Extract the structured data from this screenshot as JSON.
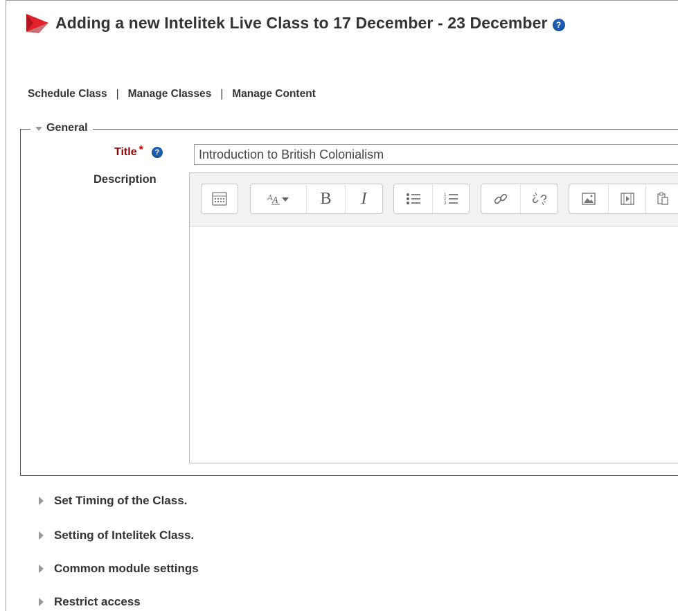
{
  "page": {
    "title": "Adding a new Intelitek Live Class to 17 December - 23 December",
    "help": "?"
  },
  "nav": {
    "items": [
      "Schedule Class",
      "Manage Classes",
      "Manage Content"
    ],
    "separator": "|"
  },
  "general": {
    "legend": "General",
    "title_label": "Title",
    "required_mark": "*",
    "help": "?",
    "title_value": "Introduction to British Colonialism",
    "description_label": "Description"
  },
  "editor": {
    "toolbar": [
      [
        "toolbar-toggle-icon"
      ],
      [
        "font-style-icon",
        "bold-icon",
        "italic-icon"
      ],
      [
        "bullet-list-icon",
        "numbered-list-icon"
      ],
      [
        "link-icon",
        "unlink-icon"
      ],
      [
        "image-icon",
        "media-icon",
        "paste-icon"
      ]
    ],
    "bold_glyph": "B",
    "italic_glyph": "I",
    "content": ""
  },
  "sections": [
    "Set Timing of the Class.",
    "Setting of Intelitek Class.",
    "Common module settings",
    "Restrict access"
  ],
  "colors": {
    "required": "#990000",
    "logo_red": "#e0202a",
    "help_blue": "#1e5fb3"
  }
}
